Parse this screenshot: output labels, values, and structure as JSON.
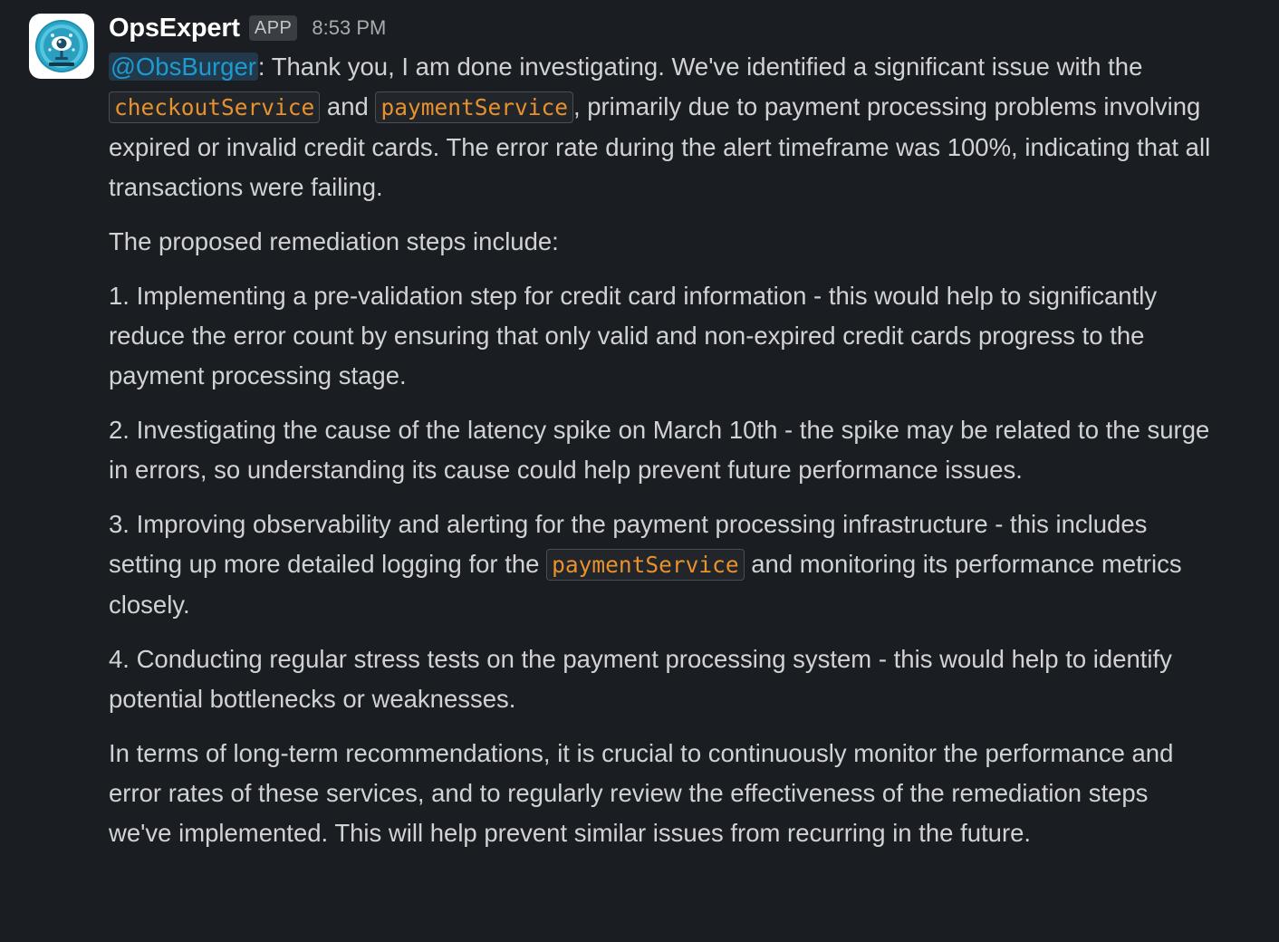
{
  "message": {
    "sender": "OpsExpert",
    "badge": "APP",
    "timestamp": "8:53 PM",
    "avatar_icon": "robot-eye-icon",
    "paragraphs": {
      "p1": {
        "mention": "@ObsBurger",
        "text_a": ": Thank you, I am done investigating. We've identified a significant issue with the ",
        "code_1": "checkoutService",
        "text_b": " and ",
        "code_2": "paymentService",
        "text_c": ", primarily due to payment processing problems involving expired or invalid credit cards. The error rate during the alert timeframe was 100%, indicating that all transactions were failing."
      },
      "p2": "The proposed remediation steps include:",
      "p3": "1. Implementing a pre-validation step for credit card information - this would help to significantly reduce the error count by ensuring that only valid and non-expired credit cards progress to the payment processing stage.",
      "p4": "2. Investigating the cause of the latency spike on March 10th - the spike may be related to the surge in errors, so understanding its cause could help prevent future performance issues.",
      "p5": {
        "text_a": "3. Improving observability and alerting for the payment processing infrastructure - this includes setting up more detailed logging for the ",
        "code": "paymentService",
        "text_b": " and monitoring its performance metrics closely."
      },
      "p6": "4. Conducting regular stress tests on the payment processing system - this would help to identify potential bottlenecks or weaknesses.",
      "p7": "In terms of long-term recommendations, it is crucial to continuously monitor the performance and error rates of these services, and to regularly review the effectiveness of the remediation steps we've implemented. This will help prevent similar issues from recurring in the future."
    }
  },
  "colors": {
    "background": "#1a1d21",
    "text": "#d1d2d3",
    "mention": "#1d9bd1",
    "code": "#e8912d",
    "avatar_accent": "#2aa7c7"
  }
}
